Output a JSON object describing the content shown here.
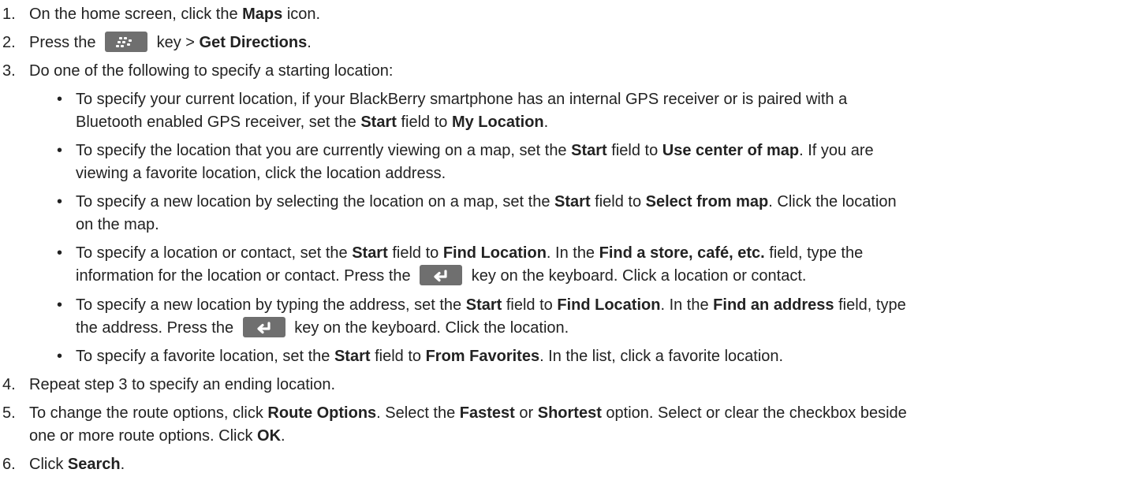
{
  "steps": [
    {
      "num": "1.",
      "segments": [
        {
          "text": "On the home screen, click the "
        },
        {
          "text": "Maps",
          "bold": true
        },
        {
          "text": " icon."
        }
      ]
    },
    {
      "num": "2.",
      "segments": [
        {
          "text": "Press the "
        },
        {
          "key": "menu-key-icon"
        },
        {
          "text": " key > "
        },
        {
          "text": "Get Directions",
          "bold": true
        },
        {
          "text": "."
        }
      ]
    },
    {
      "num": "3.",
      "segments": [
        {
          "text": "Do one of the following to specify a starting location:"
        }
      ]
    },
    {
      "num": "4.",
      "segments": [
        {
          "text": "Repeat step 3 to specify an ending location."
        }
      ]
    },
    {
      "num": "5.",
      "segments": [
        {
          "text": "To change the route options, click "
        },
        {
          "text": "Route Options",
          "bold": true
        },
        {
          "text": ". Select the "
        },
        {
          "text": "Fastest",
          "bold": true
        },
        {
          "text": " or "
        },
        {
          "text": "Shortest",
          "bold": true
        },
        {
          "text": " option. Select or clear the checkbox beside"
        }
      ]
    },
    {
      "num": "",
      "segments": [
        {
          "text": "one or more route options. Click "
        },
        {
          "text": "OK",
          "bold": true
        },
        {
          "text": "."
        }
      ]
    },
    {
      "num": "6.",
      "segments": [
        {
          "text": "Click "
        },
        {
          "text": "Search",
          "bold": true
        },
        {
          "text": "."
        }
      ]
    }
  ],
  "bullet_glyph": "•",
  "bullets": [
    {
      "lines": [
        [
          {
            "text": "To specify your current location, if your BlackBerry smartphone has an internal GPS receiver or is paired with a"
          }
        ],
        [
          {
            "text": "Bluetooth enabled GPS receiver, set the "
          },
          {
            "text": "Start",
            "bold": true
          },
          {
            "text": " field to "
          },
          {
            "text": "My Location",
            "bold": true
          },
          {
            "text": "."
          }
        ]
      ]
    },
    {
      "lines": [
        [
          {
            "text": "To specify the location that you are currently viewing on a map, set the "
          },
          {
            "text": "Start",
            "bold": true
          },
          {
            "text": " field to "
          },
          {
            "text": "Use center of map",
            "bold": true
          },
          {
            "text": ". If you are"
          }
        ],
        [
          {
            "text": "viewing a favorite location, click the location address."
          }
        ]
      ]
    },
    {
      "lines": [
        [
          {
            "text": "To specify a new location by selecting the location on a map, set the "
          },
          {
            "text": "Start",
            "bold": true
          },
          {
            "text": " field to "
          },
          {
            "text": "Select from map",
            "bold": true
          },
          {
            "text": ". Click the location"
          }
        ],
        [
          {
            "text": "on the map."
          }
        ]
      ]
    },
    {
      "lines": [
        [
          {
            "text": "To specify a location or contact, set the "
          },
          {
            "text": "Start",
            "bold": true
          },
          {
            "text": " field to "
          },
          {
            "text": "Find Location",
            "bold": true
          },
          {
            "text": ". In the "
          },
          {
            "text": "Find a store, café, etc.",
            "bold": true
          },
          {
            "text": " field, type the"
          }
        ],
        [
          {
            "text": "information for the location or contact. Press the "
          },
          {
            "key": "enter-key-icon"
          },
          {
            "text": " key on the keyboard. Click a location or contact."
          }
        ]
      ]
    },
    {
      "lines": [
        [
          {
            "text": "To specify a new location by typing the address, set the "
          },
          {
            "text": "Start",
            "bold": true
          },
          {
            "text": " field to "
          },
          {
            "text": "Find Location",
            "bold": true
          },
          {
            "text": ". In the "
          },
          {
            "text": "Find an address",
            "bold": true
          },
          {
            "text": " field, type"
          }
        ],
        [
          {
            "text": "the address. Press the "
          },
          {
            "key": "enter-key-icon"
          },
          {
            "text": " key on the keyboard. Click the location."
          }
        ]
      ]
    },
    {
      "lines": [
        [
          {
            "text": "To specify a favorite location, set the "
          },
          {
            "text": "Start",
            "bold": true
          },
          {
            "text": " field to "
          },
          {
            "text": "From Favorites",
            "bold": true
          },
          {
            "text": ". In the list, click a favorite location."
          }
        ]
      ]
    }
  ]
}
